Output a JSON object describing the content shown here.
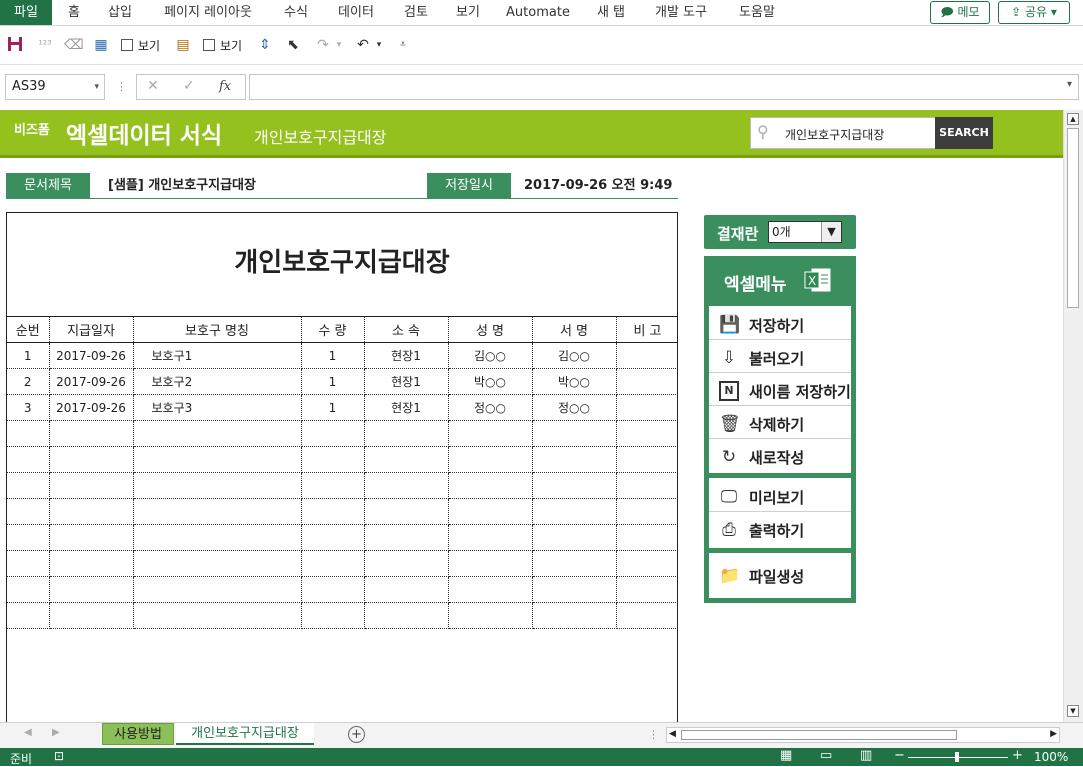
{
  "ribbon": {
    "tabs": [
      "파일",
      "홈",
      "삽입",
      "페이지 레이아웃",
      "수식",
      "데이터",
      "검토",
      "보기",
      "Automate",
      "새 탭",
      "개발 도구",
      "도움말"
    ],
    "memo_label": "메모",
    "share_label": "공유"
  },
  "qat": {
    "check1_label": "보기",
    "check2_label": "보기"
  },
  "formula_bar": {
    "name_box": "AS39",
    "cancel_glyph": "✕",
    "confirm_glyph": "✓",
    "fx_glyph": "fx",
    "formula": ""
  },
  "banner": {
    "logo": "비즈폼",
    "title": "엑셀데이터 서식",
    "subtitle": "개인보호구지급대장",
    "search_value": "개인보호구지급대장",
    "search_button": "SEARCH"
  },
  "doc_info": {
    "title_label": "문서제목",
    "title_value": "[샘플] 개인보호구지급대장",
    "date_label": "저장일시",
    "date_value": "2017-09-26  오전 9:49"
  },
  "sheet": {
    "heading": "개인보호구지급대장",
    "columns": [
      "순번",
      "지급일자",
      "보호구 명칭",
      "수 량",
      "소 속",
      "성 명",
      "서 명",
      "비 고"
    ],
    "rows": [
      [
        "1",
        "2017-09-26",
        "보호구1",
        "1",
        "현장1",
        "김○○",
        "김○○",
        ""
      ],
      [
        "2",
        "2017-09-26",
        "보호구2",
        "1",
        "현장1",
        "박○○",
        "박○○",
        ""
      ],
      [
        "3",
        "2017-09-26",
        "보호구3",
        "1",
        "현장1",
        "정○○",
        "정○○",
        ""
      ]
    ]
  },
  "approval": {
    "label": "결재란",
    "value": "0개"
  },
  "excel_menu": {
    "title": "엑셀메뉴",
    "group1": [
      {
        "label": "저장하기",
        "icon": "save-icon",
        "glyph": "💾"
      },
      {
        "label": "불러오기",
        "icon": "download-icon",
        "glyph": "⇩"
      },
      {
        "label": "새이름 저장하기",
        "icon": "new-name-save-icon",
        "glyph": "N"
      },
      {
        "label": "삭제하기",
        "icon": "trash-icon",
        "glyph": "🗑"
      },
      {
        "label": "새로작성",
        "icon": "new-document-icon",
        "glyph": "↻"
      }
    ],
    "group2": [
      {
        "label": "미리보기",
        "icon": "preview-icon",
        "glyph": "🖵"
      },
      {
        "label": "출력하기",
        "icon": "print-icon",
        "glyph": "⎙"
      }
    ],
    "group3": [
      {
        "label": "파일생성",
        "icon": "folder-icon",
        "glyph": "📁"
      }
    ]
  },
  "sheet_tabs": [
    "사용방법",
    "개인보호구지급대장"
  ],
  "status": {
    "ready": "준비",
    "zoom": "100%"
  },
  "colors": {
    "excel_green": "#217346",
    "banner_green": "#95c11f",
    "panel_green": "#3b8f5e"
  }
}
